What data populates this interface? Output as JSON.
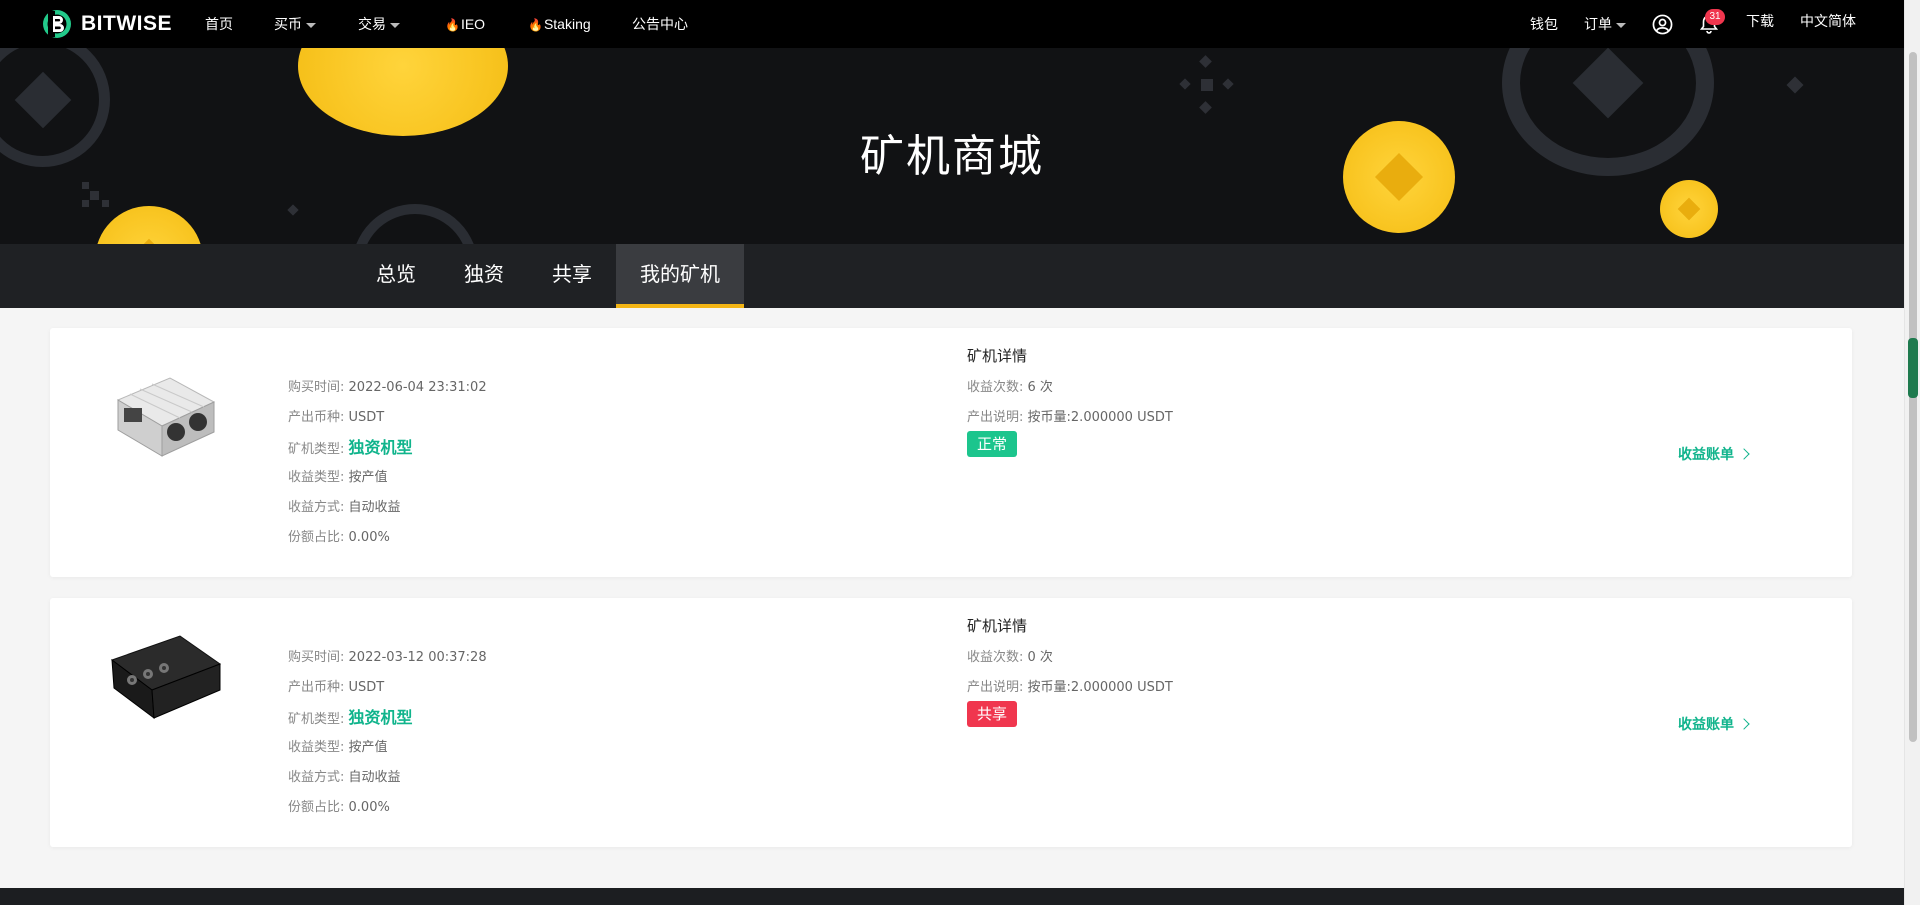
{
  "nav": {
    "brand": "BITWISE",
    "home": "首页",
    "buy": "买币",
    "trade": "交易",
    "ieo": "IEO",
    "staking": "Staking",
    "announcements": "公告中心",
    "wallet": "钱包",
    "orders": "订单",
    "notification_count": "31",
    "download": "下载",
    "language": "中文简体"
  },
  "banner": {
    "title": "矿机商城"
  },
  "tabs": [
    {
      "label": "总览"
    },
    {
      "label": "独资"
    },
    {
      "label": "共享"
    },
    {
      "label": "我的矿机"
    }
  ],
  "active_tab": "我的矿机",
  "miners": [
    {
      "purchase_time_label": "购买时间:",
      "purchase_time": "2022-06-04 23:31:02",
      "coin_label": "产出币种:",
      "coin": "USDT",
      "type_label": "矿机类型:",
      "type": "独资机型",
      "income_type_label": "收益类型:",
      "income_type": "按产值",
      "income_method_label": "收益方式:",
      "income_method": "自动收益",
      "share_label": "份额占比:",
      "share": "0.00%",
      "detail_title": "矿机详情",
      "count_label": "收益次数:",
      "count": "6 次",
      "output_label": "产出说明:",
      "output": "按币量:2.000000 USDT",
      "status": "正常",
      "status_color": "#1cc58d",
      "bill_link": "收益账单"
    },
    {
      "purchase_time_label": "购买时间:",
      "purchase_time": "2022-03-12 00:37:28",
      "coin_label": "产出币种:",
      "coin": "USDT",
      "type_label": "矿机类型:",
      "type": "独资机型",
      "income_type_label": "收益类型:",
      "income_type": "按产值",
      "income_method_label": "收益方式:",
      "income_method": "自动收益",
      "share_label": "份额占比:",
      "share": "0.00%",
      "detail_title": "矿机详情",
      "count_label": "收益次数:",
      "count": "0 次",
      "output_label": "产出说明:",
      "output": "按币量:2.000000 USDT",
      "status": "共享",
      "status_color": "#f0364e",
      "bill_link": "收益账单"
    }
  ],
  "colors": {
    "accent_green": "#10b48c",
    "coin_gold": "#f9c623",
    "tab_underline": "#f3b515"
  },
  "icons": [
    "bitwise-logo-icon",
    "caret-down-icon",
    "fire-icon",
    "user-circle-icon",
    "bell-icon",
    "chevron-right-icon",
    "asic-miner-image",
    "black-miner-image"
  ]
}
